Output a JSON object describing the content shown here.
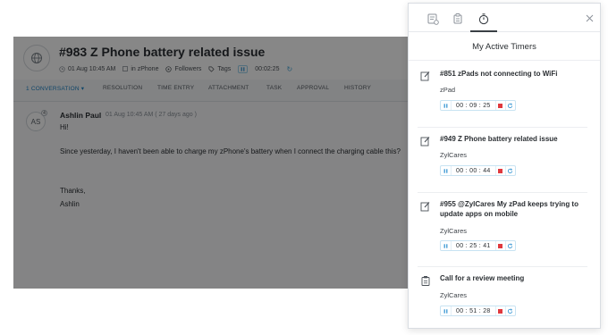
{
  "ticket": {
    "title": "#983  Z Phone battery related issue",
    "date": "01 Aug 10:45 AM",
    "product": "in zPhone",
    "followers": "Followers",
    "tags": "Tags",
    "elapsed": "00:02:25",
    "tabs": [
      "1 CONVERSATION ▾",
      "RESOLUTION",
      "TIME ENTRY",
      "ATTACHMENT",
      "TASK",
      "APPROVAL",
      "HISTORY"
    ],
    "conversation": {
      "avatar_initials": "AS",
      "author": "Ashlin Paul",
      "date": "01 Aug 10:45 AM ( 27 days ago )",
      "greeting": "Hi!",
      "body": "Since yesterday, I haven't been able to charge my zPhone's battery when I connect the charging cable this?",
      "signoff": "Thanks,",
      "signature": "Ashlin"
    }
  },
  "panel": {
    "title": "My Active Timers",
    "tab_icons": [
      "ticket-icon",
      "task-icon",
      "timer-icon"
    ],
    "active_tab": 2,
    "timers": [
      {
        "icon": "ticket-icon",
        "title": "#851 zPads not connecting to WiFi",
        "org": "zPad",
        "time": "00 : 09 : 25"
      },
      {
        "icon": "ticket-icon",
        "title": "#949 Z Phone battery related issue",
        "org": "ZylCares",
        "time": "00 : 00 : 44"
      },
      {
        "icon": "ticket-icon",
        "title": "#955 @ZylCares My zPad keeps trying to update apps on mobile",
        "org": "ZylCares",
        "time": "00 : 25 : 41"
      },
      {
        "icon": "task-icon",
        "title": "Call for a review meeting",
        "org": "ZylCares",
        "time": "00 : 51 : 28"
      }
    ]
  },
  "colors": {
    "accent": "#1f84c6",
    "stop": "#e0393e",
    "dim_overlay": "rgba(0,0,0,0.47)"
  }
}
